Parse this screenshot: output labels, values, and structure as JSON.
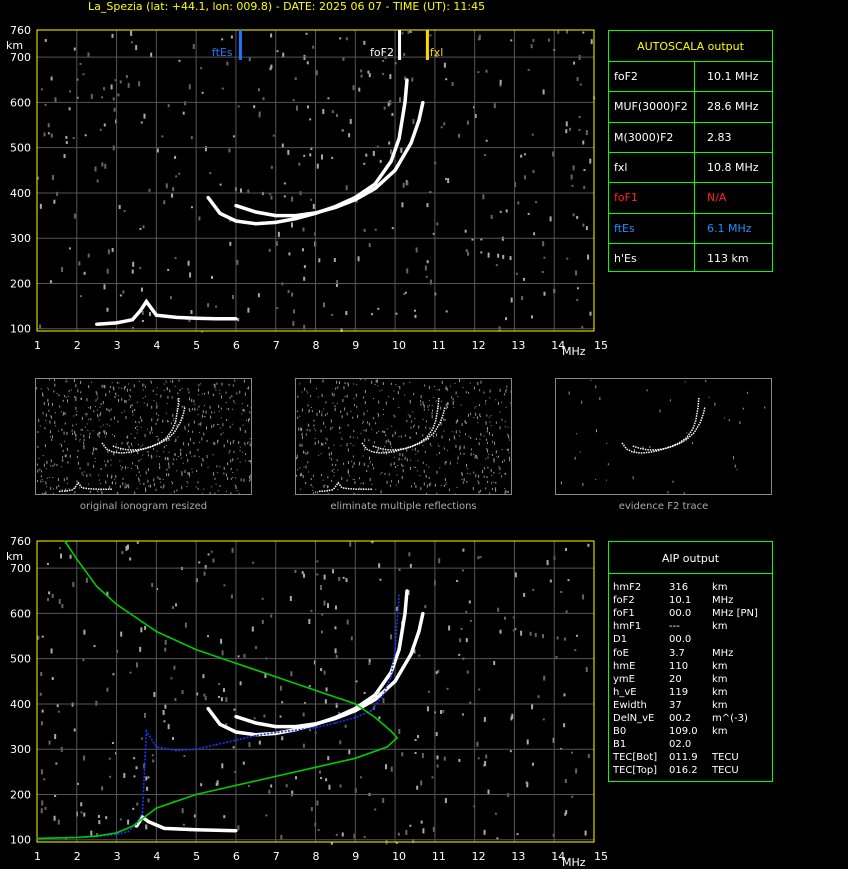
{
  "header": {
    "title": "La_Spezia (lat: +44.1, lon: 009.8) - DATE: 2025 06 07 - TIME (UT): 11:45"
  },
  "axes": {
    "y_unit": "km",
    "x_unit": "MHz",
    "y_ticks": [
      "100",
      "200",
      "300",
      "400",
      "500",
      "600",
      "700",
      "760"
    ],
    "x_ticks": [
      "1",
      "2",
      "3",
      "4",
      "5",
      "6",
      "7",
      "8",
      "9",
      "10",
      "11",
      "12",
      "13",
      "14",
      "15"
    ]
  },
  "markers": {
    "ftEs": {
      "label": "ftEs",
      "freq": 6.1,
      "color": "#1e78ff"
    },
    "foF2": {
      "label": "foF2",
      "freq": 10.1,
      "color": "#ffffff"
    },
    "fxl": {
      "label": "fxl",
      "freq": 10.8,
      "color": "#ffd700"
    }
  },
  "autoscala": {
    "title": "AUTOSCALA output",
    "rows": [
      {
        "name": "foF2",
        "value": "10.1 MHz",
        "color": "#ffffff"
      },
      {
        "name": "MUF(3000)F2",
        "value": "28.6 MHz",
        "color": "#ffffff"
      },
      {
        "name": "M(3000)F2",
        "value": "2.83",
        "color": "#ffffff"
      },
      {
        "name": "fxl",
        "value": "10.8 MHz",
        "color": "#ffffff"
      },
      {
        "name": "foF1",
        "value": "N/A",
        "color": "#ff2020"
      },
      {
        "name": "ftEs",
        "value": "6.1 MHz",
        "color": "#1e90ff"
      },
      {
        "name": "h'Es",
        "value": "113    km",
        "color": "#ffffff"
      }
    ]
  },
  "thumbnails": [
    {
      "caption": "original ionogram resized"
    },
    {
      "caption": "eliminate multiple reflections"
    },
    {
      "caption": "evidence F2 trace"
    }
  ],
  "aip": {
    "title": "AIP output",
    "rows": [
      {
        "name": "hmF2",
        "value": "316",
        "unit": "km"
      },
      {
        "name": "foF2",
        "value": "10.1",
        "unit": "MHz"
      },
      {
        "name": "foF1",
        "value": "00.0",
        "unit": "MHz   [PN]"
      },
      {
        "name": "hmF1",
        "value": "---",
        "unit": "km"
      },
      {
        "name": "D1",
        "value": "00.0",
        "unit": ""
      },
      {
        "name": "foE",
        "value": "3.7",
        "unit": "MHz"
      },
      {
        "name": "hmE",
        "value": "110",
        "unit": "km"
      },
      {
        "name": "ymE",
        "value": "20",
        "unit": "km"
      },
      {
        "name": "h_vE",
        "value": "119",
        "unit": "km"
      },
      {
        "name": "Ewidth",
        "value": "37",
        "unit": "km"
      },
      {
        "name": "DelN_vE",
        "value": "00.2",
        "unit": "m^(-3)"
      },
      {
        "name": "B0",
        "value": "109.0",
        "unit": "km"
      },
      {
        "name": "B1",
        "value": "02.0",
        "unit": ""
      },
      {
        "name": "TEC[Bot]",
        "value": "011.9",
        "unit": "TECU"
      },
      {
        "name": "TEC[Top]",
        "value": "016.2",
        "unit": "TECU"
      }
    ]
  },
  "chart_data": [
    {
      "type": "scatter",
      "xlabel": "MHz",
      "ylabel": "km",
      "xlim": [
        1,
        15
      ],
      "ylim": [
        95,
        760
      ],
      "grid": true,
      "series": [
        {
          "color": "#ffffff",
          "points": [
            [
              2.5,
              110
            ],
            [
              3.0,
              113
            ],
            [
              3.4,
              120
            ],
            [
              3.6,
              140
            ],
            [
              3.75,
              160
            ],
            [
              4.0,
              130
            ],
            [
              4.5,
              125
            ],
            [
              5.0,
              123
            ],
            [
              5.5,
              122
            ],
            [
              6.0,
              122
            ]
          ]
        },
        {
          "color": "#ffffff",
          "points": [
            [
              5.3,
              390
            ],
            [
              5.6,
              355
            ],
            [
              6.0,
              338
            ],
            [
              6.5,
              332
            ],
            [
              7.0,
              335
            ],
            [
              7.5,
              343
            ],
            [
              8.0,
              355
            ],
            [
              8.5,
              370
            ],
            [
              9.0,
              390
            ],
            [
              9.5,
              420
            ],
            [
              9.9,
              470
            ],
            [
              10.1,
              520
            ],
            [
              10.25,
              600
            ],
            [
              10.3,
              650
            ]
          ]
        },
        {
          "color": "#ffffff",
          "points": [
            [
              6.0,
              372
            ],
            [
              6.5,
              358
            ],
            [
              7.0,
              350
            ],
            [
              7.5,
              350
            ],
            [
              8.0,
              356
            ],
            [
              8.5,
              368
            ],
            [
              9.0,
              385
            ],
            [
              9.5,
              410
            ],
            [
              10.0,
              450
            ],
            [
              10.4,
              510
            ],
            [
              10.6,
              560
            ],
            [
              10.7,
              600
            ]
          ]
        }
      ]
    },
    {
      "type": "scatter",
      "xlabel": "MHz",
      "ylabel": "km",
      "xlim": [
        1,
        15
      ],
      "ylim": [
        95,
        760
      ],
      "grid": true,
      "series": [
        {
          "color": "#ffffff",
          "points": [
            [
              3.5,
              130
            ],
            [
              3.65,
              150
            ],
            [
              3.8,
              140
            ],
            [
              4.2,
              125
            ],
            [
              5.0,
              122
            ],
            [
              6.0,
              120
            ]
          ]
        },
        {
          "color": "#ffffff",
          "points": [
            [
              5.3,
              390
            ],
            [
              5.6,
              355
            ],
            [
              6.0,
              338
            ],
            [
              6.5,
              332
            ],
            [
              7.0,
              335
            ],
            [
              7.5,
              343
            ],
            [
              8.0,
              355
            ],
            [
              8.5,
              370
            ],
            [
              9.0,
              390
            ],
            [
              9.5,
              420
            ],
            [
              9.9,
              470
            ],
            [
              10.1,
              520
            ],
            [
              10.25,
              600
            ],
            [
              10.3,
              650
            ]
          ]
        },
        {
          "color": "#ffffff",
          "points": [
            [
              6.0,
              372
            ],
            [
              6.5,
              358
            ],
            [
              7.0,
              350
            ],
            [
              7.5,
              350
            ],
            [
              8.0,
              356
            ],
            [
              8.5,
              368
            ],
            [
              9.0,
              385
            ],
            [
              9.5,
              410
            ],
            [
              10.0,
              450
            ],
            [
              10.4,
              510
            ],
            [
              10.6,
              560
            ],
            [
              10.7,
              600
            ]
          ]
        },
        {
          "color": "#2030ff",
          "points": [
            [
              1.0,
              103
            ],
            [
              1.5,
              104
            ],
            [
              2.0,
              105
            ],
            [
              2.5,
              107
            ],
            [
              3.0,
              112
            ],
            [
              3.3,
              118
            ],
            [
              3.5,
              135
            ],
            [
              3.65,
              160
            ],
            [
              3.75,
              340
            ],
            [
              4.0,
              305
            ],
            [
              4.5,
              297
            ],
            [
              5.0,
              300
            ],
            [
              5.5,
              310
            ],
            [
              6.0,
              320
            ],
            [
              6.5,
              330
            ],
            [
              7.0,
              337
            ],
            [
              7.5,
              342
            ],
            [
              8.0,
              348
            ],
            [
              8.5,
              358
            ],
            [
              9.0,
              370
            ],
            [
              9.4,
              385
            ],
            [
              9.7,
              420
            ],
            [
              9.9,
              460
            ],
            [
              10.0,
              520
            ],
            [
              10.1,
              640
            ]
          ]
        },
        {
          "color": "#00cc00",
          "points": [
            [
              1.7,
              760
            ],
            [
              2.0,
              720
            ],
            [
              2.5,
              660
            ],
            [
              3.0,
              620
            ],
            [
              3.5,
              590
            ],
            [
              4.0,
              560
            ],
            [
              5.0,
              520
            ],
            [
              6.0,
              490
            ],
            [
              7.0,
              460
            ],
            [
              8.0,
              430
            ],
            [
              9.0,
              400
            ],
            [
              9.5,
              370
            ],
            [
              9.9,
              340
            ],
            [
              10.05,
              325
            ],
            [
              9.8,
              305
            ],
            [
              9.0,
              280
            ],
            [
              8.0,
              260
            ],
            [
              7.0,
              240
            ],
            [
              6.0,
              220
            ],
            [
              5.0,
              200
            ],
            [
              4.0,
              170
            ],
            [
              3.7,
              150
            ],
            [
              3.4,
              130
            ],
            [
              3.0,
              115
            ],
            [
              2.5,
              108
            ],
            [
              2.0,
              105
            ],
            [
              1.0,
              103
            ]
          ]
        }
      ]
    }
  ]
}
